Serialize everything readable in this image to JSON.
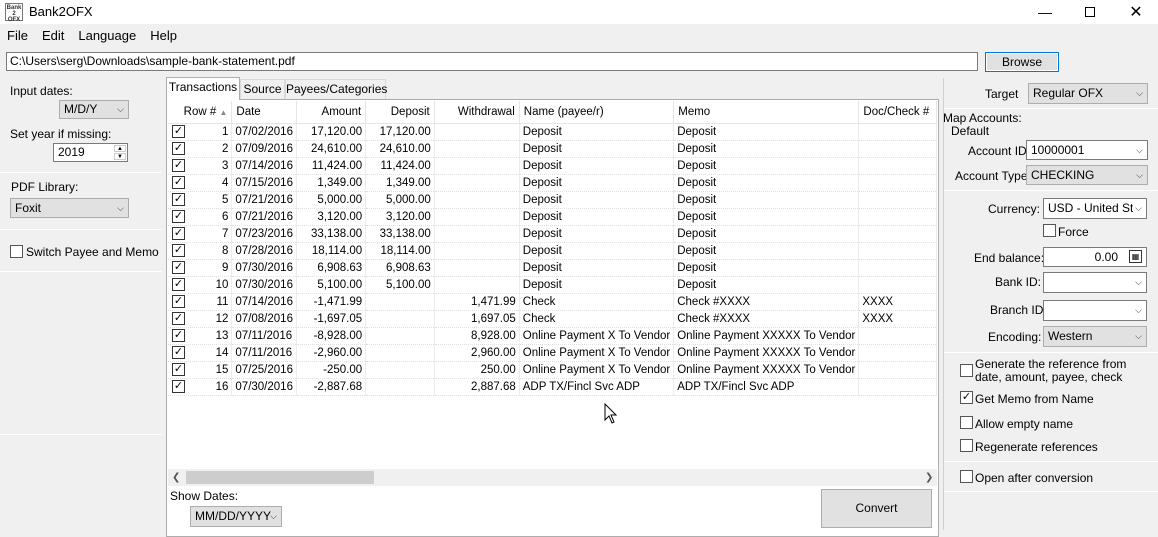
{
  "window": {
    "title": "Bank2OFX",
    "icon_text": "Bank\n2\nOFX"
  },
  "menu": [
    "File",
    "Edit",
    "Language",
    "Help"
  ],
  "file": {
    "path": "C:\\Users\\serg\\Downloads\\sample-bank-statement.pdf",
    "browse_label": "Browse"
  },
  "left": {
    "input_dates_label": "Input dates:",
    "input_dates_value": "M/D/Y",
    "set_year_label": "Set year if missing:",
    "set_year_value": "2019",
    "pdf_library_label": "PDF Library:",
    "pdf_library_value": "Foxit",
    "switch_label": "Switch Payee and Memo",
    "switch_checked": false
  },
  "tabs": [
    "Transactions",
    "Source",
    "Payees/Categories"
  ],
  "table": {
    "columns": [
      "Row #",
      "Date",
      "Amount",
      "Deposit",
      "Withdrawal",
      "Name (payee/r)",
      "Memo",
      "Doc/Check #"
    ],
    "rows": [
      [
        "1",
        "07/02/2016",
        "17,120.00",
        "17,120.00",
        "",
        "Deposit",
        "Deposit",
        ""
      ],
      [
        "2",
        "07/09/2016",
        "24,610.00",
        "24,610.00",
        "",
        "Deposit",
        "Deposit",
        ""
      ],
      [
        "3",
        "07/14/2016",
        "11,424.00",
        "11,424.00",
        "",
        "Deposit",
        "Deposit",
        ""
      ],
      [
        "4",
        "07/15/2016",
        "1,349.00",
        "1,349.00",
        "",
        "Deposit",
        "Deposit",
        ""
      ],
      [
        "5",
        "07/21/2016",
        "5,000.00",
        "5,000.00",
        "",
        "Deposit",
        "Deposit",
        ""
      ],
      [
        "6",
        "07/21/2016",
        "3,120.00",
        "3,120.00",
        "",
        "Deposit",
        "Deposit",
        ""
      ],
      [
        "7",
        "07/23/2016",
        "33,138.00",
        "33,138.00",
        "",
        "Deposit",
        "Deposit",
        ""
      ],
      [
        "8",
        "07/28/2016",
        "18,114.00",
        "18,114.00",
        "",
        "Deposit",
        "Deposit",
        ""
      ],
      [
        "9",
        "07/30/2016",
        "6,908.63",
        "6,908.63",
        "",
        "Deposit",
        "Deposit",
        ""
      ],
      [
        "10",
        "07/30/2016",
        "5,100.00",
        "5,100.00",
        "",
        "Deposit",
        "Deposit",
        ""
      ],
      [
        "11",
        "07/14/2016",
        "-1,471.99",
        "",
        "1,471.99",
        "Check",
        "Check #XXXX",
        "XXXX"
      ],
      [
        "12",
        "07/08/2016",
        "-1,697.05",
        "",
        "1,697.05",
        "Check",
        "Check #XXXX",
        "XXXX"
      ],
      [
        "13",
        "07/11/2016",
        "-8,928.00",
        "",
        "8,928.00",
        "Online Payment X To Vendor",
        "Online Payment XXXXX To Vendor",
        ""
      ],
      [
        "14",
        "07/11/2016",
        "-2,960.00",
        "",
        "2,960.00",
        "Online Payment X To Vendor",
        "Online Payment XXXXX To Vendor",
        ""
      ],
      [
        "15",
        "07/25/2016",
        "-250.00",
        "",
        "250.00",
        "Online Payment X To Vendor",
        "Online Payment XXXXX To Vendor",
        ""
      ],
      [
        "16",
        "07/30/2016",
        "-2,887.68",
        "",
        "2,887.68",
        "ADP TX/Fincl Svc ADP",
        "ADP TX/Fincl Svc ADP",
        ""
      ]
    ]
  },
  "bottom": {
    "show_dates_label": "Show Dates:",
    "show_dates_value": "MM/DD/YYYY",
    "convert_label": "Convert"
  },
  "right": {
    "target_label": "Target",
    "target_value": "Regular OFX",
    "map_accounts_label": "Map Accounts:",
    "default_label": "Default",
    "account_id_label": "Account ID:",
    "account_id_value": "10000001",
    "account_type_label": "Account Type:",
    "account_type_value": "CHECKING",
    "currency_label": "Currency:",
    "currency_value": "USD - United Sta",
    "force_label": "Force",
    "end_balance_label": "End balance:",
    "end_balance_value": "0.00",
    "bank_id_label": "Bank ID:",
    "branch_id_label": "Branch ID",
    "encoding_label": "Encoding:",
    "encoding_value": "Western",
    "options": [
      {
        "label": "Generate the reference from date, amount, payee, check",
        "checked": false
      },
      {
        "label": "Get Memo from Name",
        "checked": true
      },
      {
        "label": "Allow empty name",
        "checked": false
      },
      {
        "label": "Regenerate references",
        "checked": false
      }
    ],
    "open_after_label": "Open after conversion",
    "open_after_checked": false
  }
}
